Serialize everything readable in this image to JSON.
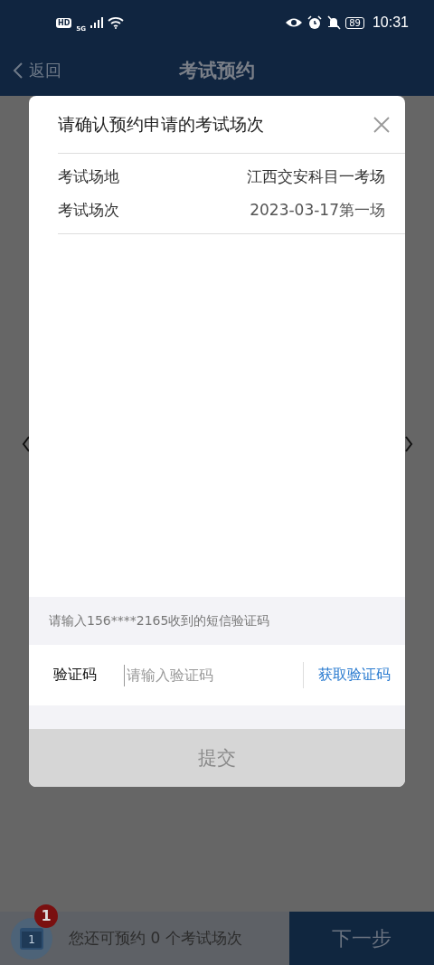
{
  "status_bar": {
    "hd": "HD",
    "network": "5G",
    "battery": "89",
    "time": "10:31"
  },
  "header": {
    "back": "返回",
    "title": "考试预约"
  },
  "dialog": {
    "title": "请确认预约申请的考试场次",
    "details": [
      {
        "label": "考试场地",
        "value": "江西交安科目一考场"
      },
      {
        "label": "考试场次",
        "value": "2023-03-17第一场"
      }
    ],
    "sms_hint": "请输入156****2165收到的短信验证码",
    "code_label": "验证码",
    "code_placeholder": "请输入验证码",
    "get_code": "获取验证码",
    "submit": {
      "label": "提交",
      "disabled": true
    }
  },
  "bottom_bar": {
    "badge": "1",
    "calendar_day": "1",
    "remaining": "您还可预约 0 个考试场次",
    "next": "下一步"
  }
}
